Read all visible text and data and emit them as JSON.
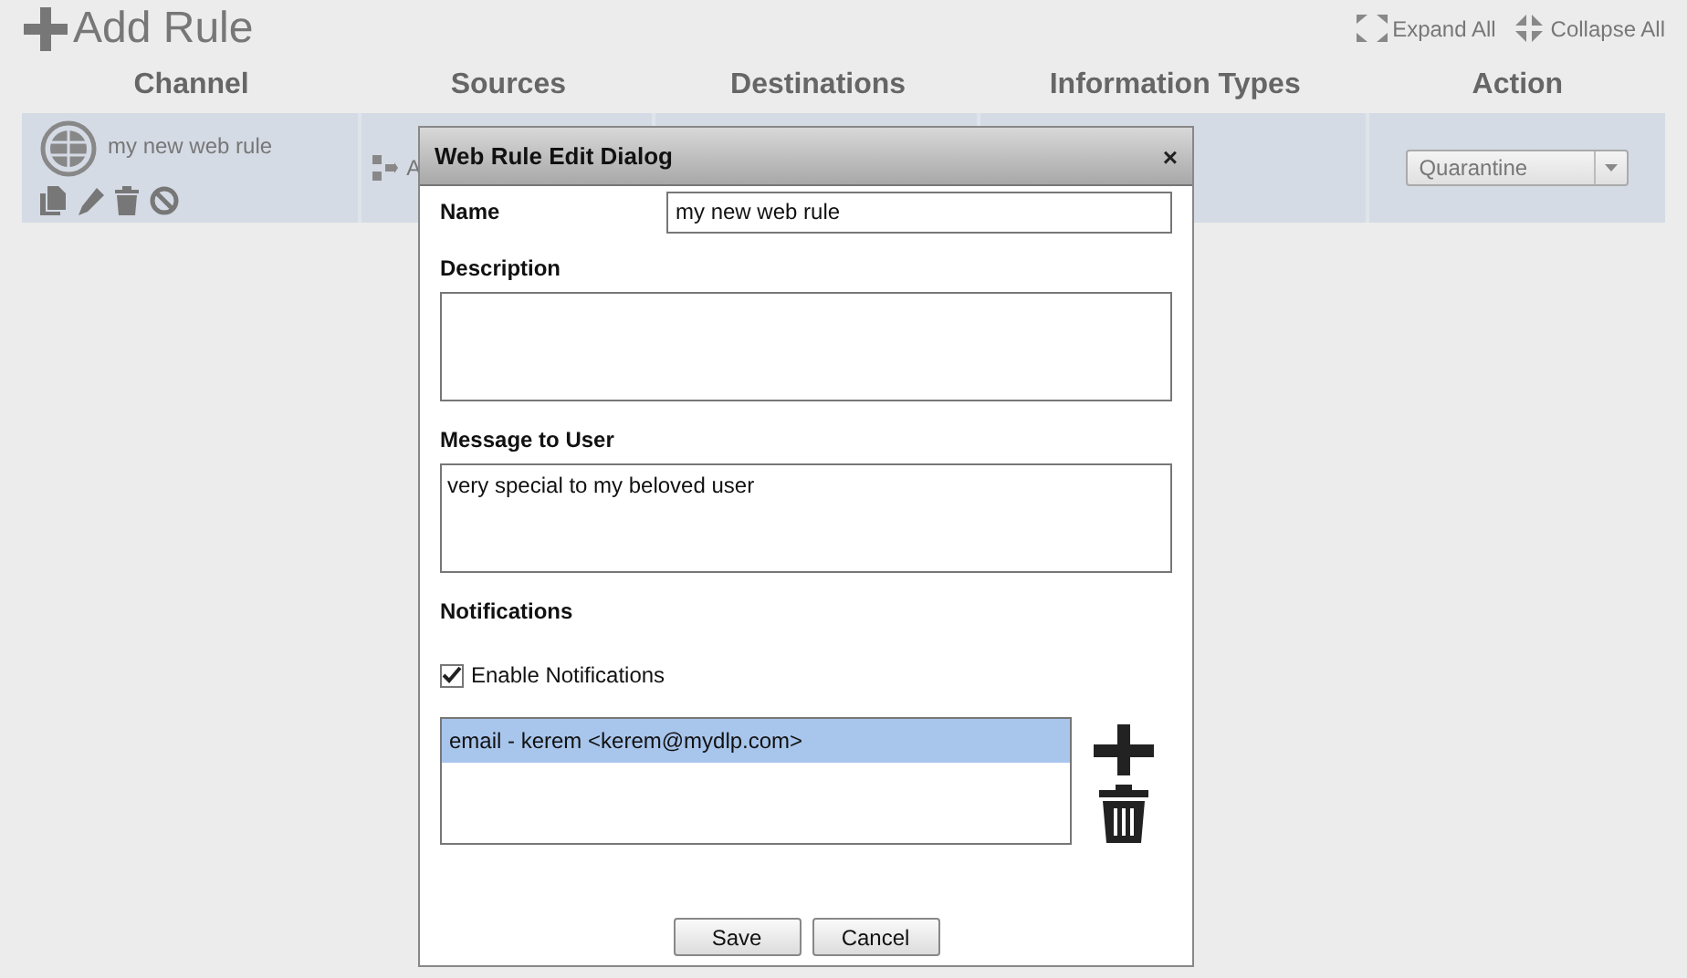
{
  "toolbar": {
    "add_rule": "Add Rule",
    "expand_all": "Expand All",
    "collapse_all": "Collapse All"
  },
  "table": {
    "columns": [
      "Channel",
      "Sources",
      "Destinations",
      "Information Types",
      "Action"
    ],
    "rows": [
      {
        "channel": "my new web rule",
        "sources": "A",
        "action": "Quarantine"
      }
    ]
  },
  "dialog": {
    "title": "Web Rule Edit Dialog",
    "close": "×",
    "name": {
      "label": "Name",
      "value": "my new web rule"
    },
    "description": {
      "label": "Description"
    },
    "message": {
      "label": "Message to User",
      "value": "very special to my beloved user"
    },
    "notifications": {
      "label": "Notifications",
      "enable": {
        "label": "Enable Notifications",
        "checked": true
      },
      "items": [
        {
          "label": "email - kerem <kerem@mydlp.com>",
          "selected": true
        }
      ]
    },
    "buttons": [
      "Save",
      "Cancel"
    ]
  }
}
